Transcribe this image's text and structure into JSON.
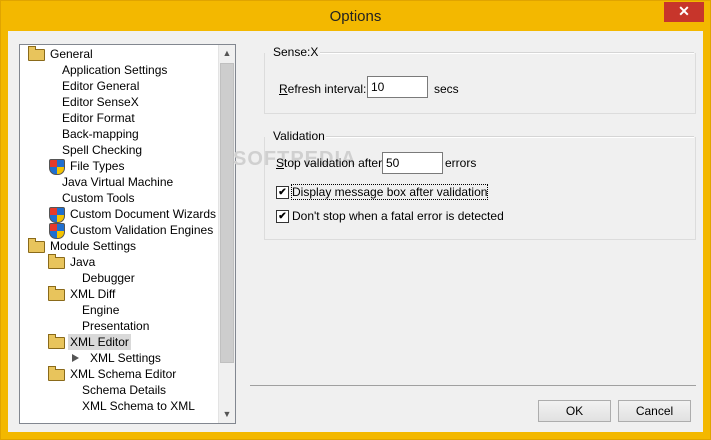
{
  "window": {
    "title": "Options",
    "close_glyph": "✕"
  },
  "tree": {
    "items": [
      {
        "label": "General",
        "icon": "folder-icon",
        "level": 0
      },
      {
        "label": "Application Settings",
        "icon": "none",
        "level": 1
      },
      {
        "label": "Editor General",
        "icon": "none",
        "level": 1
      },
      {
        "label": "Editor SenseX",
        "icon": "none",
        "level": 1
      },
      {
        "label": "Editor Format",
        "icon": "none",
        "level": 1
      },
      {
        "label": "Back-mapping",
        "icon": "none",
        "level": 1
      },
      {
        "label": "Spell Checking",
        "icon": "none",
        "level": 1
      },
      {
        "label": "File Types",
        "icon": "shield-icon",
        "level": 1
      },
      {
        "label": "Java Virtual Machine",
        "icon": "none",
        "level": 1
      },
      {
        "label": "Custom Tools",
        "icon": "none",
        "level": 1
      },
      {
        "label": "Custom Document Wizards",
        "icon": "shield-icon",
        "level": 1
      },
      {
        "label": "Custom Validation Engines",
        "icon": "shield-icon",
        "level": 1
      },
      {
        "label": "Module Settings",
        "icon": "folder-icon",
        "level": 0
      },
      {
        "label": "Java",
        "icon": "folder-icon",
        "level": 1
      },
      {
        "label": "Debugger",
        "icon": "none",
        "level": 2
      },
      {
        "label": "XML Diff",
        "icon": "folder-icon",
        "level": 1
      },
      {
        "label": "Engine",
        "icon": "none",
        "level": 2
      },
      {
        "label": "Presentation",
        "icon": "none",
        "level": 2
      },
      {
        "label": "XML Editor",
        "icon": "folder-icon",
        "level": 1,
        "selected": true
      },
      {
        "label": "XML Settings",
        "icon": "arrow-icon",
        "level": 2
      },
      {
        "label": "XML Schema Editor",
        "icon": "folder-icon",
        "level": 1
      },
      {
        "label": "Schema Details",
        "icon": "none",
        "level": 2
      },
      {
        "label": "XML Schema to XML",
        "icon": "none",
        "level": 2
      }
    ],
    "scroll_up_glyph": "▲",
    "scroll_down_glyph": "▼"
  },
  "sensex": {
    "group_title": "Sense:X",
    "refresh_label_access": "R",
    "refresh_label_rest": "efresh interval:",
    "refresh_value": "10",
    "refresh_unit": "secs"
  },
  "validation": {
    "group_title": "Validation",
    "stop_label_access": "S",
    "stop_label_rest": "top validation after:",
    "stop_value": "50",
    "stop_unit": "errors",
    "check1_label": "Display message box after validation",
    "check1_checked": "✔",
    "check2_label": "Don't stop when a fatal error is detected",
    "check2_checked": "✔"
  },
  "buttons": {
    "ok": "OK",
    "cancel": "Cancel"
  },
  "watermark": "SOFTPEDIA"
}
